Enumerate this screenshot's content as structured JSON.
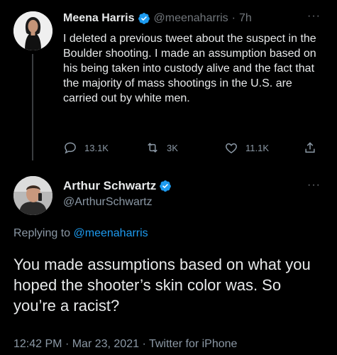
{
  "tweet1": {
    "author_name": "Meena Harris",
    "handle": "@meenaharris",
    "separator": "·",
    "time": "7h",
    "text": "I deleted a previous tweet about the suspect in the Boulder shooting. I made an assumption based on his being taken into custody alive and the fact that the majority of mass shootings in the U.S. are carried out by white men.",
    "replies": "13.1K",
    "retweets": "3K",
    "likes": "11.1K",
    "more": "···"
  },
  "tweet2": {
    "author_name": "Arthur Schwartz",
    "handle": "@ArthurSchwartz",
    "replying_prefix": "Replying to",
    "replying_to": "@meenaharris",
    "text": "You made assumptions based on what you hoped the shooter’s skin color was. So you’re a racist?",
    "time": "12:42 PM",
    "date": "Mar 23, 2021",
    "source": "Twitter for iPhone",
    "separator": "·",
    "more": "···"
  },
  "colors": {
    "background": "#000000",
    "text": "#e7e9ea",
    "muted": "#8b98a5",
    "link": "#1d9bf0",
    "verified": "#1d9bf0"
  },
  "icons": [
    "verified-badge-icon",
    "reply-icon",
    "retweet-icon",
    "like-icon",
    "share-icon",
    "more-icon"
  ]
}
